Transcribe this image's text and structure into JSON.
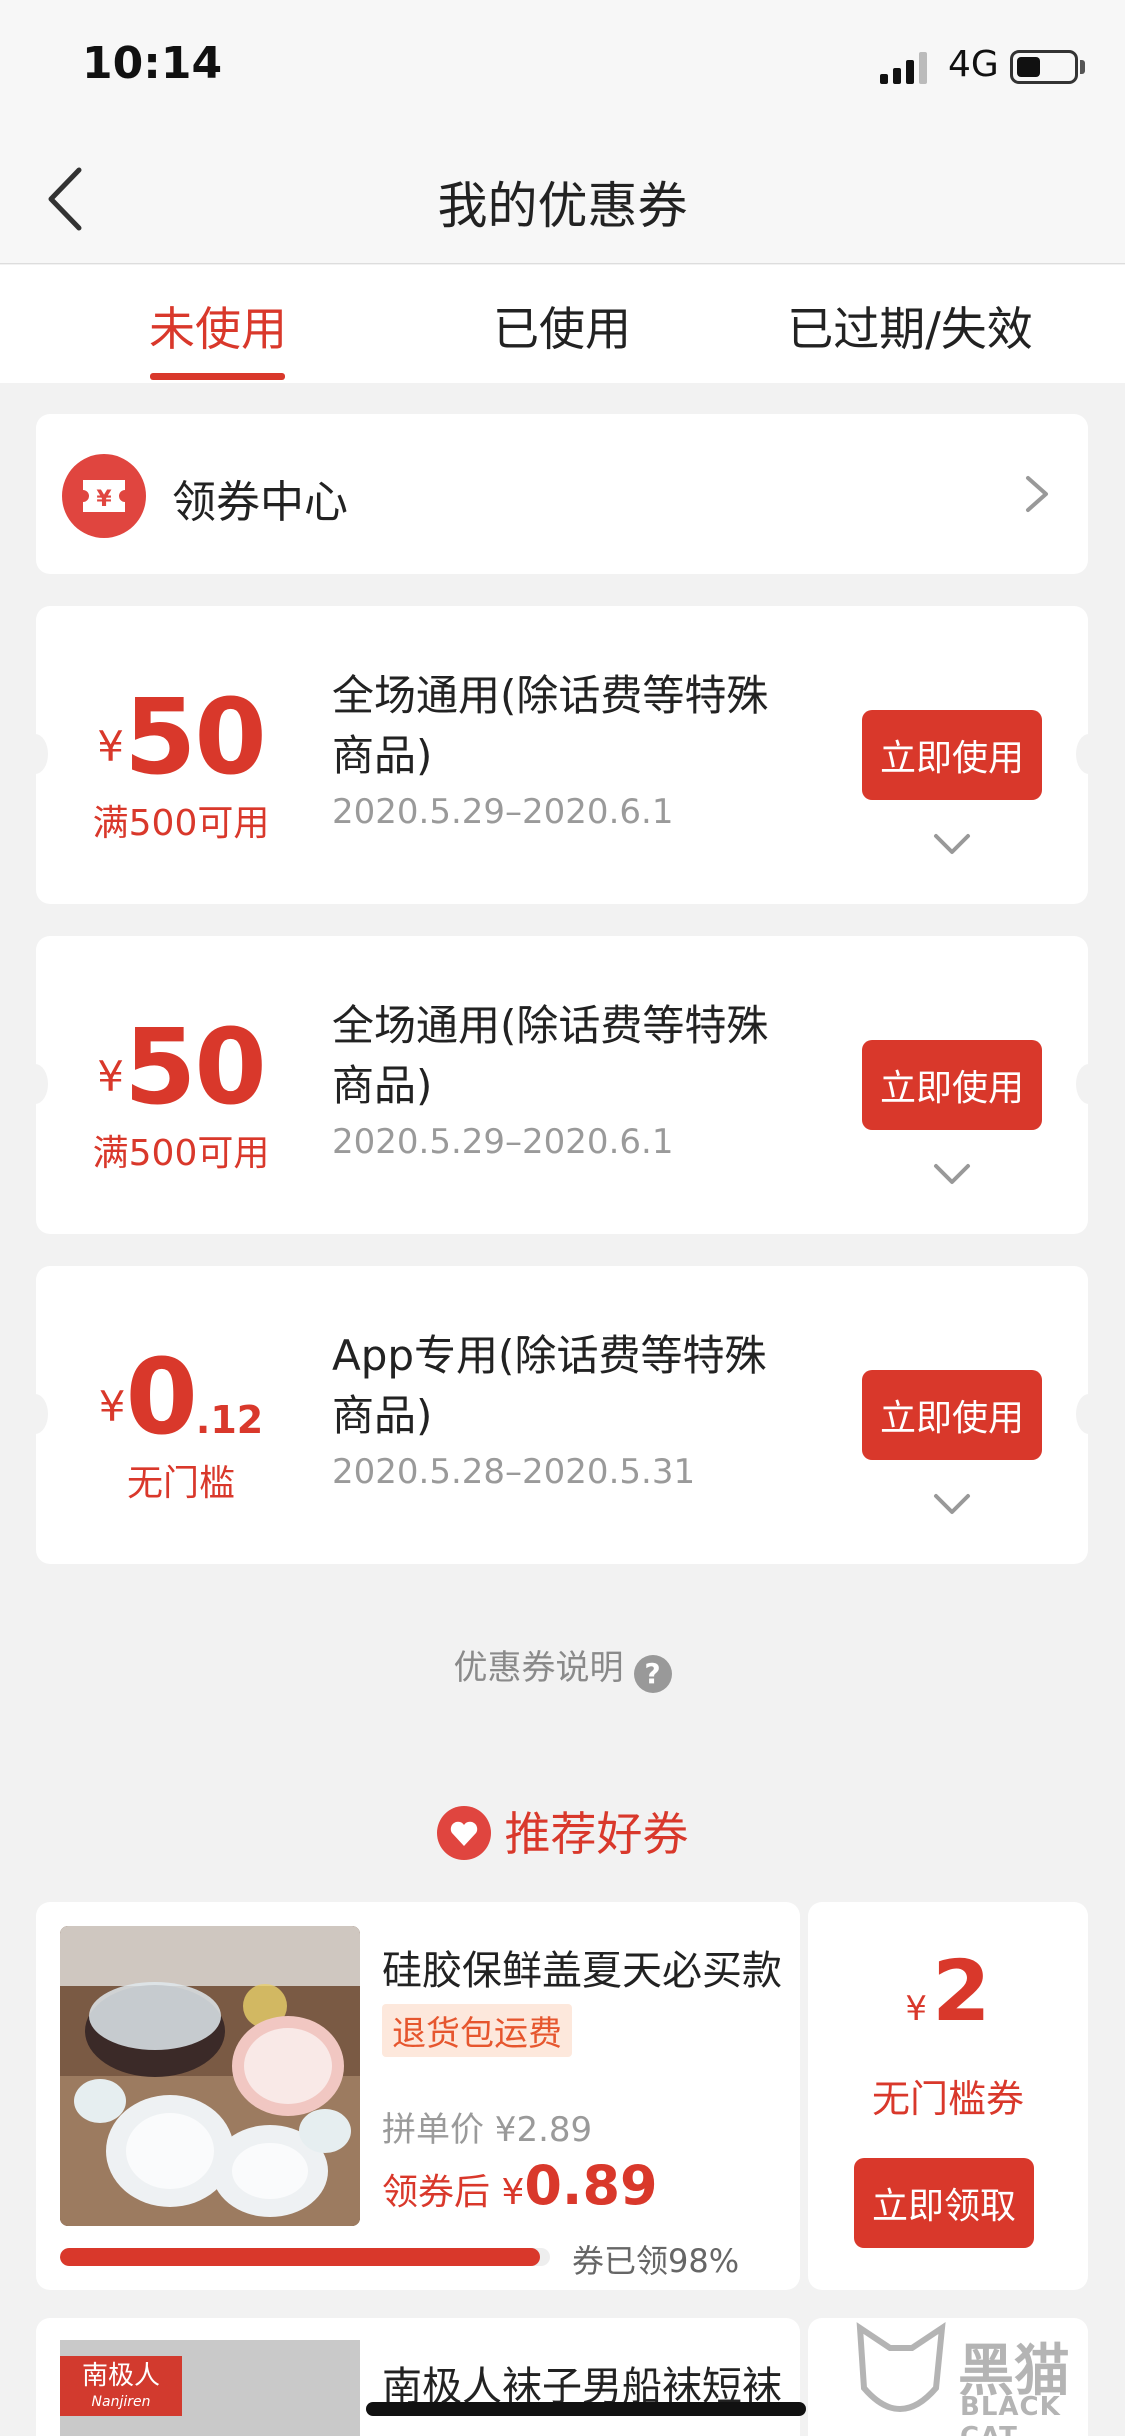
{
  "status": {
    "time": "10:14",
    "network": "4G",
    "battery_level": 0.4
  },
  "nav": {
    "title": "我的优惠券"
  },
  "tabs": [
    {
      "label": "未使用",
      "active": true
    },
    {
      "label": "已使用",
      "active": false
    },
    {
      "label": "已过期/失效",
      "active": false
    }
  ],
  "coupon_center": {
    "label": "领券中心"
  },
  "coupons": [
    {
      "currency": "¥",
      "amount": "50",
      "decimal": "",
      "condition": "满500可用",
      "title": "全场通用(除话费等特殊商品)",
      "date": "2020.5.29–2020.6.1",
      "button": "立即使用"
    },
    {
      "currency": "¥",
      "amount": "50",
      "decimal": "",
      "condition": "满500可用",
      "title": "全场通用(除话费等特殊商品)",
      "date": "2020.5.29–2020.6.1",
      "button": "立即使用"
    },
    {
      "currency": "¥",
      "amount": "0",
      "decimal": ".12",
      "condition": "无门槛",
      "title": "App专用(除话费等特殊商品)",
      "date": "2020.5.28–2020.5.31",
      "button": "立即使用"
    }
  ],
  "explain": {
    "label": "优惠券说明",
    "icon": "question-icon"
  },
  "recommend": {
    "title": "推荐好券",
    "items": [
      {
        "title": "硅胶保鲜盖夏天必买款",
        "tag": "退货包运费",
        "group_price": "拼单价 ¥2.89",
        "after_label": "领券后 ",
        "after_currency": "¥",
        "after_price": "0.89",
        "claimed_text": "券已领98%",
        "claimed_percent": 98,
        "voucher_currency": "¥",
        "voucher_amount": "2",
        "voucher_condition": "无门槛券",
        "voucher_button": "立即领取"
      },
      {
        "brand": "南极人",
        "brand_en": "Nanjiren",
        "title": "南极人袜子男船袜短袜"
      }
    ]
  },
  "watermark": {
    "text": "黑猫",
    "sub": "BLACK CAT"
  },
  "colors": {
    "accent": "#d9382b",
    "background": "#f2f2f2"
  }
}
